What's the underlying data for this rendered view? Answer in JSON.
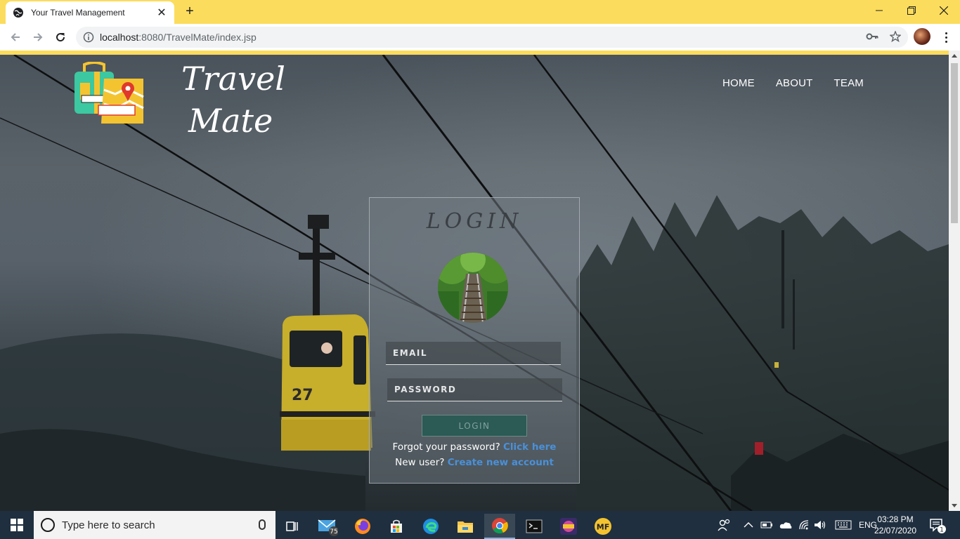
{
  "browser": {
    "tab_title": "Your Travel Management",
    "url_host": "localhost",
    "url_rest": ":8080/TravelMate/index.jsp"
  },
  "site": {
    "brand_line1": "Travel",
    "brand_line2": "Mate",
    "logo_text_top": "TRAVEL",
    "logo_text_bottom": "MATE",
    "nav": [
      "HOME",
      "ABOUT",
      "TEAM"
    ]
  },
  "login": {
    "title": "LOGIN",
    "email_placeholder": "EMAIL",
    "password_placeholder": "PASSWORD",
    "button_label": "LOGIN",
    "forgot_text": "Forgot your password?",
    "forgot_link": "Click here",
    "new_user_text": "New user?",
    "new_user_link": "Create new account"
  },
  "scene": {
    "gondola_number": "27"
  },
  "taskbar": {
    "search_placeholder": "Type here to search",
    "mail_badge": "75",
    "language": "ENG",
    "time": "03:28 PM",
    "date": "22/07/2020",
    "notification_count": "1",
    "mf_label": "MF"
  }
}
